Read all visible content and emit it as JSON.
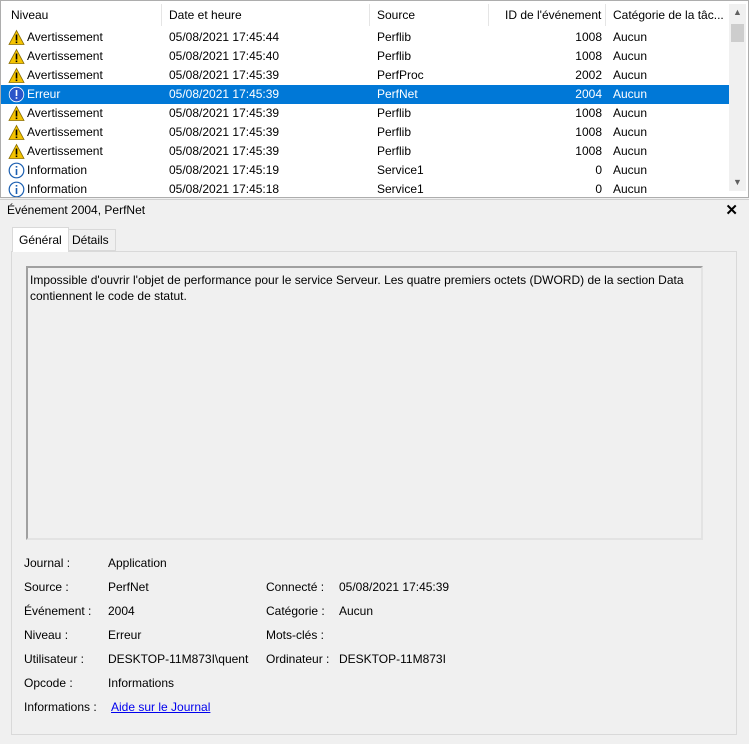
{
  "columns": [
    "Niveau",
    "Date et heure",
    "Source",
    "ID de l'événement",
    "Catégorie de la tâc..."
  ],
  "rows": [
    {
      "level": "Avertissement",
      "icon": "warning-icon",
      "date": "05/08/2021 17:45:44",
      "source": "Perflib",
      "id": "1008",
      "category": "Aucun"
    },
    {
      "level": "Avertissement",
      "icon": "warning-icon",
      "date": "05/08/2021 17:45:40",
      "source": "Perflib",
      "id": "1008",
      "category": "Aucun"
    },
    {
      "level": "Avertissement",
      "icon": "warning-icon",
      "date": "05/08/2021 17:45:39",
      "source": "PerfProc",
      "id": "2002",
      "category": "Aucun"
    },
    {
      "level": "Erreur",
      "icon": "error-icon",
      "date": "05/08/2021 17:45:39",
      "source": "PerfNet",
      "id": "2004",
      "category": "Aucun",
      "selected": true
    },
    {
      "level": "Avertissement",
      "icon": "warning-icon",
      "date": "05/08/2021 17:45:39",
      "source": "Perflib",
      "id": "1008",
      "category": "Aucun"
    },
    {
      "level": "Avertissement",
      "icon": "warning-icon",
      "date": "05/08/2021 17:45:39",
      "source": "Perflib",
      "id": "1008",
      "category": "Aucun"
    },
    {
      "level": "Avertissement",
      "icon": "warning-icon",
      "date": "05/08/2021 17:45:39",
      "source": "Perflib",
      "id": "1008",
      "category": "Aucun"
    },
    {
      "level": "Information",
      "icon": "info-icon",
      "date": "05/08/2021 17:45:19",
      "source": "Service1",
      "id": "0",
      "category": "Aucun"
    },
    {
      "level": "Information",
      "icon": "info-icon",
      "date": "05/08/2021 17:45:18",
      "source": "Service1",
      "id": "0",
      "category": "Aucun"
    }
  ],
  "detail": {
    "title": "Événement 2004, PerfNet",
    "tabs": [
      "Général",
      "Détails"
    ],
    "message": "Impossible d'ouvrir l'objet de performance pour le service Serveur. Les quatre premiers octets (DWORD) de la section Data contiennent le code de statut.",
    "fields": {
      "journal_label": "Journal :",
      "journal_value": "Application",
      "source_label": "Source :",
      "source_value": "PerfNet",
      "connecte_label": "Connecté :",
      "connecte_value": "05/08/2021 17:45:39",
      "evenement_label": "Événement :",
      "evenement_value": "2004",
      "categorie_label": "Catégorie :",
      "categorie_value": "Aucun",
      "niveau_label": "Niveau :",
      "niveau_value": "Erreur",
      "motscles_label": "Mots-clés :",
      "utilisateur_label": "Utilisateur :",
      "utilisateur_value": "DESKTOP-11M873I\\quent",
      "ordinateur_label": "Ordinateur :",
      "ordinateur_value": "DESKTOP-11M873I",
      "opcode_label": "Opcode :",
      "opcode_value": "Informations",
      "informations_label": "Informations :",
      "informations_link": "Aide sur le Journal"
    }
  },
  "colors": {
    "selection": "#0078d7",
    "link": "#0000ee",
    "warning": "#f5c400",
    "error": "#2b55c9",
    "info": "#1b5fb1"
  }
}
